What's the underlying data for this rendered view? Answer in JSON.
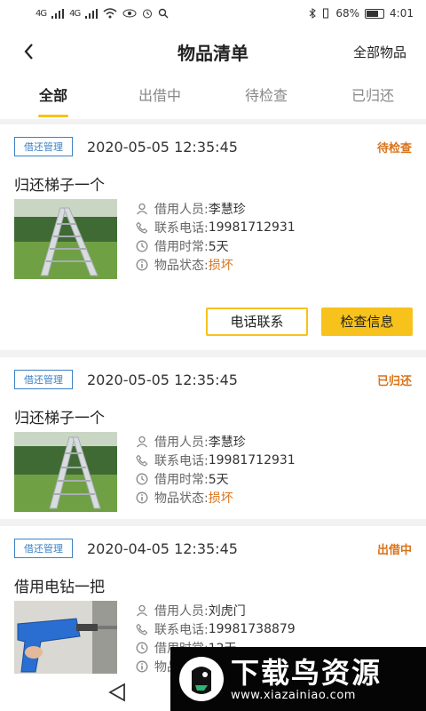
{
  "status_bar": {
    "signal_1": "4G",
    "signal_2": "4G",
    "battery": "68%",
    "time": "4:01"
  },
  "header": {
    "back_icon": "chevron-left-icon",
    "title": "物品清单",
    "right_link": "全部物品"
  },
  "tabs": [
    {
      "label": "全部",
      "active": true
    },
    {
      "label": "出借中",
      "active": false
    },
    {
      "label": "待检查",
      "active": false
    },
    {
      "label": "已归还",
      "active": false
    }
  ],
  "labels": {
    "borrower": "借用人员:",
    "phone": "联系电话:",
    "duration": "借用时常:",
    "condition": "物品状态:"
  },
  "records": [
    {
      "tag": "借还管理",
      "datetime": "2020-05-05 12:35:45",
      "status": "待检查",
      "title": "归还梯子一个",
      "image": "ladder-photo",
      "borrower": "李慧珍",
      "phone": "19981712931",
      "duration": "5天",
      "condition": "损坏",
      "buttons": {
        "contact": "电话联系",
        "check": "检查信息"
      }
    },
    {
      "tag": "借还管理",
      "datetime": "2020-05-05 12:35:45",
      "status": "已归还",
      "title": "归还梯子一个",
      "image": "ladder-photo",
      "borrower": "李慧珍",
      "phone": "19981712931",
      "duration": "5天",
      "condition": "损坏"
    },
    {
      "tag": "借还管理",
      "datetime": "2020-04-05 12:35:45",
      "status": "出借中",
      "title": "借用电钻一把",
      "image": "drill-photo",
      "borrower": "刘虎门",
      "phone": "19981738879",
      "duration": "12天",
      "condition": ""
    }
  ],
  "watermark": {
    "main": "下载鸟资源",
    "sub": "www.xiazainiao.com"
  },
  "colors": {
    "accent": "#f7c21b",
    "tag_blue": "#3b82c4",
    "status_orange": "#d9731a"
  }
}
